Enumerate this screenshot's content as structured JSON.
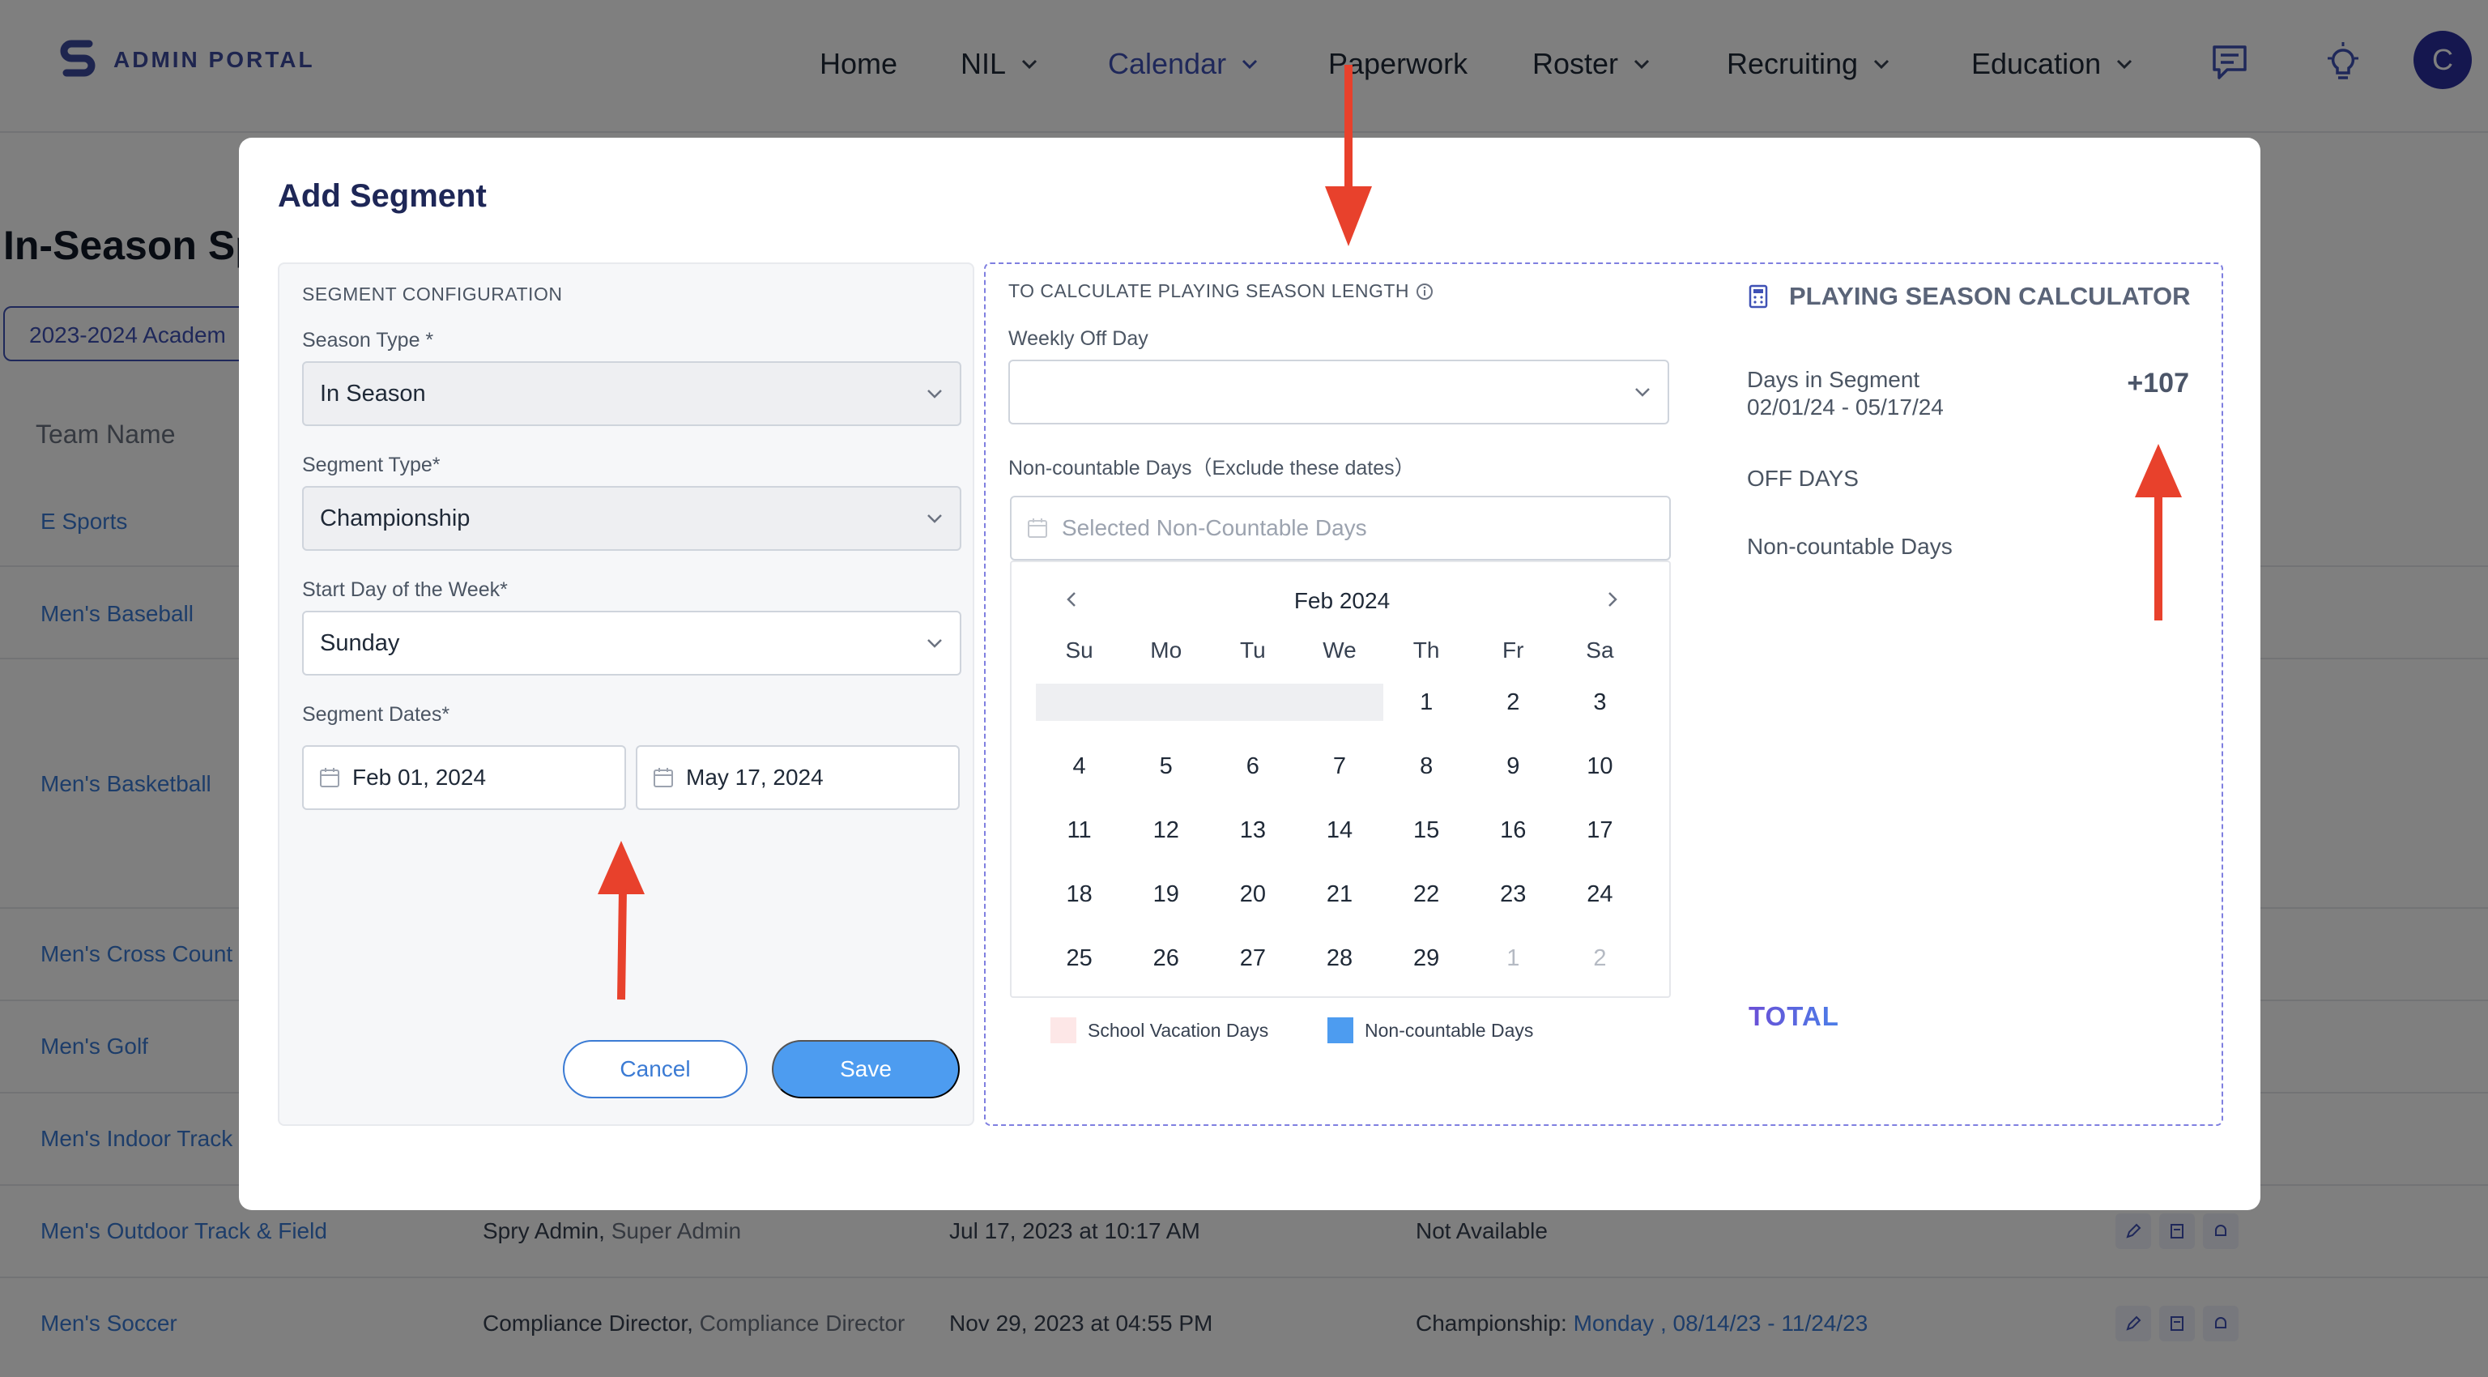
{
  "brand": {
    "name": "ADMIN PORTAL"
  },
  "nav": {
    "items": [
      {
        "label": "Home"
      },
      {
        "label": "NIL"
      },
      {
        "label": "Calendar"
      },
      {
        "label": "Paperwork"
      },
      {
        "label": "Roster"
      },
      {
        "label": "Recruiting"
      },
      {
        "label": "Education"
      }
    ],
    "avatar_initial": "C"
  },
  "page": {
    "title": "In-Season Sp",
    "year_filter": "2023-2024 Academ",
    "column_header": "Team Name",
    "teams": [
      "E Sports",
      "Men's Baseball",
      "Men's Basketball",
      "Men's Cross Count",
      "Men's Golf",
      "Men's Indoor Track",
      "Men's Outdoor Track & Field",
      "Men's Soccer"
    ],
    "rows": [
      {
        "admin": "Spry Admin,",
        "role": "Super Admin",
        "date": "Jul 17, 2023 at 10:17 AM",
        "segment": "Not Available",
        "segment_link": ""
      },
      {
        "admin": "Compliance Director,",
        "role": "Compliance Director",
        "date": "Nov 29, 2023 at 04:55 PM",
        "segment": "Championship:",
        "segment_link": "Monday , 08/14/23 - 11/24/23"
      }
    ]
  },
  "modal": {
    "title": "Add Segment",
    "config": {
      "section_title": "SEGMENT CONFIGURATION",
      "season_type_label": "Season Type *",
      "season_type_value": "In Season",
      "segment_type_label": "Segment Type*",
      "segment_type_value": "Championship",
      "start_day_label": "Start Day of the Week*",
      "start_day_value": "Sunday",
      "dates_label": "Segment Dates*",
      "start_date": "Feb 01, 2024",
      "end_date": "May 17, 2024",
      "cancel_label": "Cancel",
      "save_label": "Save"
    },
    "season_length": {
      "section_title": "TO CALCULATE PLAYING SEASON LENGTH",
      "weekly_off_label": "Weekly Off Day",
      "weekly_off_value": "",
      "noncountable_label": "Non-countable Days（Exclude these dates）",
      "noncountable_placeholder": "Selected Non-Countable Days",
      "calendar": {
        "month": "Feb 2024",
        "weekdays": [
          "Su",
          "Mo",
          "Tu",
          "We",
          "Th",
          "Fr",
          "Sa"
        ],
        "weeks": [
          [
            "",
            "",
            "",
            "",
            "1",
            "2",
            "3"
          ],
          [
            "4",
            "5",
            "6",
            "7",
            "8",
            "9",
            "10"
          ],
          [
            "11",
            "12",
            "13",
            "14",
            "15",
            "16",
            "17"
          ],
          [
            "18",
            "19",
            "20",
            "21",
            "22",
            "23",
            "24"
          ],
          [
            "25",
            "26",
            "27",
            "28",
            "29",
            "1",
            "2"
          ]
        ]
      },
      "legend": [
        {
          "label": "School Vacation Days",
          "color": "#fde7e7"
        },
        {
          "label": "Non-countable Days",
          "color": "#4d9cf0"
        }
      ]
    },
    "calculator": {
      "title": "PLAYING SEASON CALCULATOR",
      "days_in_segment_label": "Days in Segment",
      "days_in_segment_range": "02/01/24 - 05/17/24",
      "days_in_segment_value": "+107",
      "off_days_label": "OFF DAYS",
      "noncountable_label": "Non-countable Days",
      "total_label": "TOTAL"
    }
  },
  "colors": {
    "accent": "#3f51b5",
    "link": "#3b7bd4",
    "save_button": "#4d9cf0",
    "annotation_arrow": "#e8412c"
  }
}
